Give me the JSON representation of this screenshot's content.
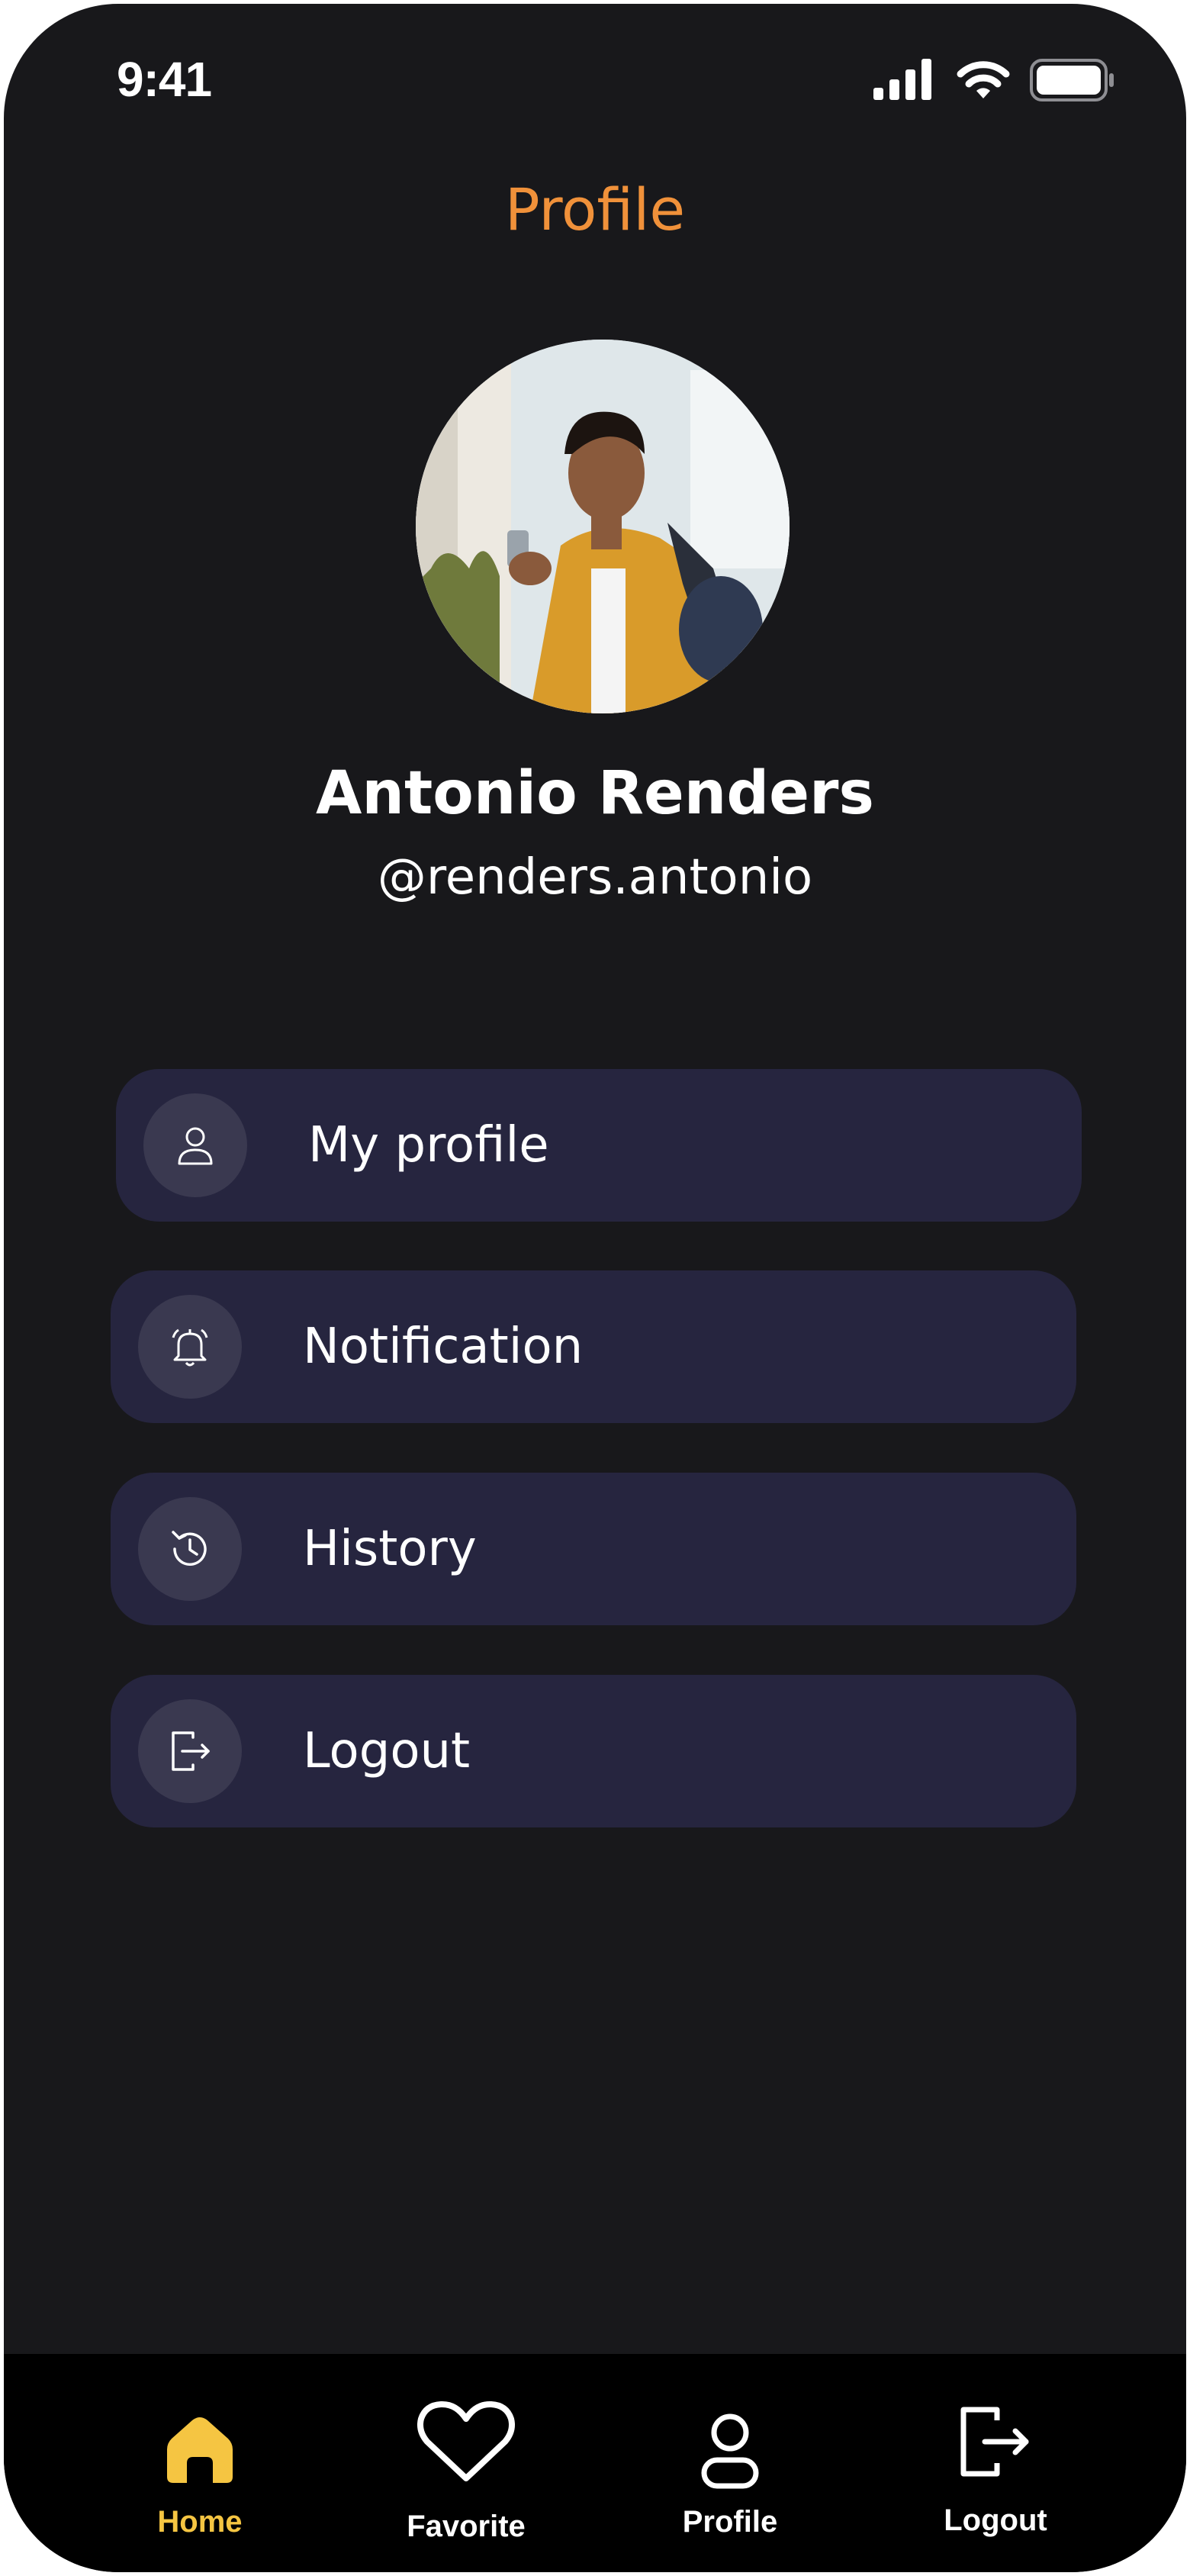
{
  "status_bar": {
    "time": "9:41",
    "icons": [
      "signal-icon",
      "wifi-icon",
      "battery-icon"
    ]
  },
  "header": {
    "title": "Profile"
  },
  "user": {
    "name": "Antonio Renders",
    "handle": "@renders.antonio"
  },
  "menu": [
    {
      "label": "My profile",
      "icon": "person-icon"
    },
    {
      "label": "Notification",
      "icon": "bell-icon"
    },
    {
      "label": "History",
      "icon": "history-icon"
    },
    {
      "label": "Logout",
      "icon": "logout-icon"
    }
  ],
  "bottom_nav": [
    {
      "label": "Home",
      "icon": "home-icon",
      "active": true
    },
    {
      "label": "Favorite",
      "icon": "heart-icon",
      "active": false
    },
    {
      "label": "Profile",
      "icon": "person-icon",
      "active": false
    },
    {
      "label": "Logout",
      "icon": "logout-icon",
      "active": false
    }
  ],
  "colors": {
    "background": "#18181b",
    "title_accent": "#f0913a",
    "menu_card": "#26253f",
    "menu_icon_circle": "#3a3950",
    "nav_active": "#f5c542",
    "nav_bar": "#000000"
  }
}
